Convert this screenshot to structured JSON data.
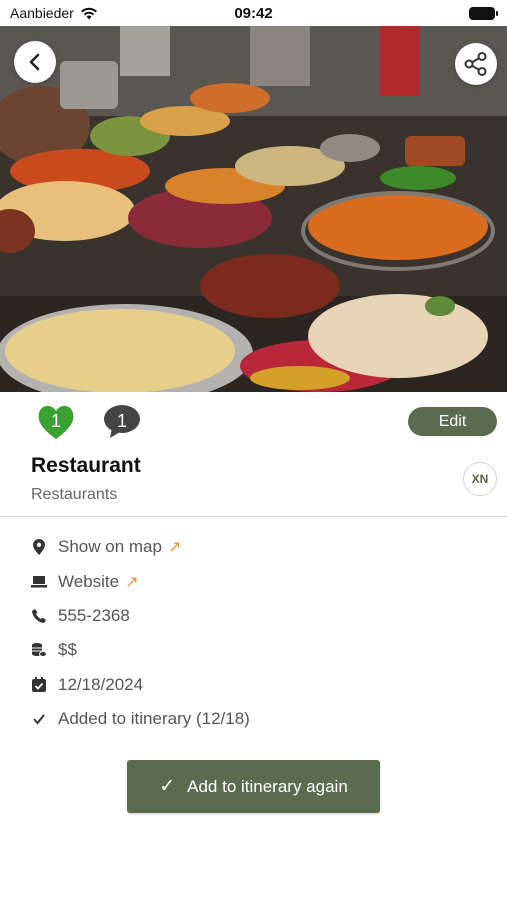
{
  "status_bar": {
    "carrier": "Aanbieder",
    "time": "09:42"
  },
  "hero": {
    "image": "street food market photo"
  },
  "reactions": {
    "likes": "1",
    "comments": "1"
  },
  "edit_label": "Edit",
  "place": {
    "name": "Restaurant",
    "category": "Restaurants",
    "avatar_initials": "XN"
  },
  "details": {
    "map": "Show on map",
    "website": "Website",
    "phone": "555-2368",
    "price": "$$",
    "date": "12/18/2024",
    "itinerary": "Added to itinerary (12/18)"
  },
  "cta_label": "Add to itinerary again",
  "colors": {
    "accent": "#5b6b4f",
    "heart": "#3aa132",
    "link_arrow": "#e39433"
  }
}
